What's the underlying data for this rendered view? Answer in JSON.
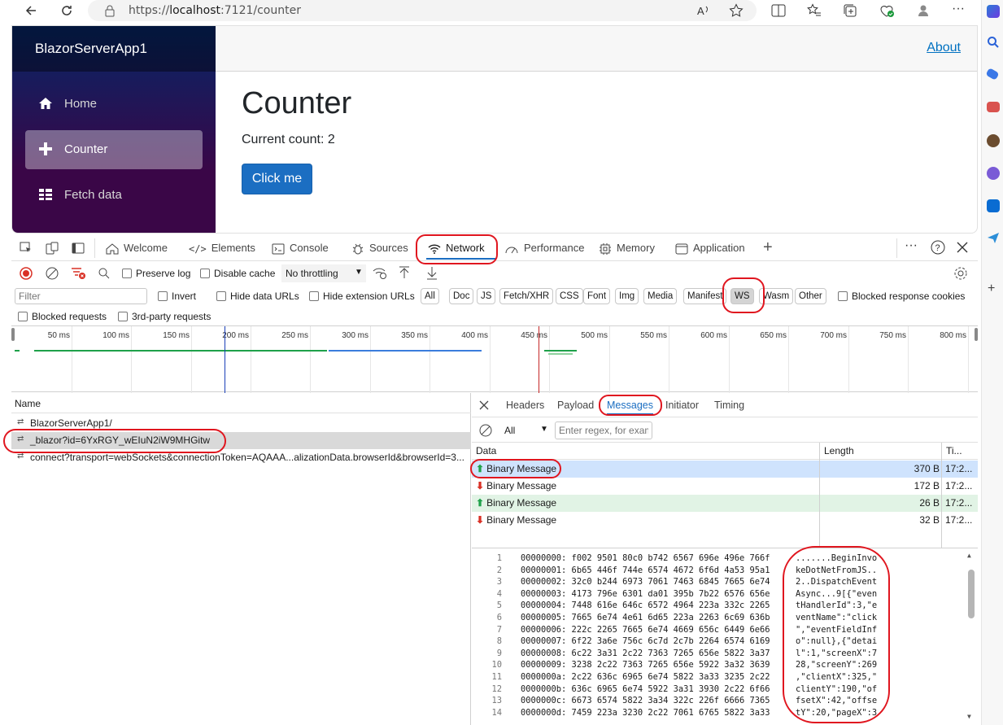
{
  "browser": {
    "url_scheme": "https://",
    "url_host": "localhost",
    "url_rest": ":7121/counter"
  },
  "app": {
    "brand": "BlazorServerApp1",
    "nav": [
      {
        "label": "Home",
        "icon": "home-icon"
      },
      {
        "label": "Counter",
        "icon": "plus-icon"
      },
      {
        "label": "Fetch data",
        "icon": "list-icon"
      }
    ],
    "about_link": "About",
    "page_title": "Counter",
    "current_count": "Current count: 2",
    "click_button": "Click me"
  },
  "devtools": {
    "tabs": [
      "Welcome",
      "Elements",
      "Console",
      "Sources",
      "Network",
      "Performance",
      "Memory",
      "Application"
    ],
    "active_tab": "Network",
    "toolbar": {
      "preserve_log": "Preserve log",
      "disable_cache": "Disable cache",
      "throttling": "No throttling"
    },
    "filter": {
      "placeholder": "Filter",
      "invert": "Invert",
      "hide_data_urls": "Hide data URLs",
      "hide_extension_urls": "Hide extension URLs",
      "types": [
        "All",
        "Doc",
        "JS",
        "Fetch/XHR",
        "CSS",
        "Font",
        "Img",
        "Media",
        "Manifest",
        "WS",
        "Wasm",
        "Other"
      ],
      "active_type": "WS",
      "blocked_response_cookies": "Blocked response cookies",
      "blocked_requests": "Blocked requests",
      "third_party_requests": "3rd-party requests"
    },
    "timeline_ticks": [
      "50 ms",
      "100 ms",
      "150 ms",
      "200 ms",
      "250 ms",
      "300 ms",
      "350 ms",
      "400 ms",
      "450 ms",
      "500 ms",
      "550 ms",
      "600 ms",
      "650 ms",
      "700 ms",
      "750 ms",
      "800 ms"
    ],
    "requests_header": "Name",
    "requests": [
      {
        "name": "BlazorServerApp1/"
      },
      {
        "name": "_blazor?id=6YxRGY_wEIuN2iW9MHGitw"
      },
      {
        "name": "connect?transport=webSockets&connectionToken=AQAAA...alizationData.browserId&browserId=3..."
      }
    ],
    "detail_tabs": [
      "Headers",
      "Payload",
      "Messages",
      "Initiator",
      "Timing"
    ],
    "active_detail_tab": "Messages",
    "message_filter": {
      "select": "All",
      "placeholder": "Enter regex, for exam"
    },
    "messages_columns": [
      "Data",
      "Length",
      "Ti..."
    ],
    "messages": [
      {
        "direction": "up",
        "data": "Binary Message",
        "length": "370 B",
        "time": "17:2..."
      },
      {
        "direction": "down",
        "data": "Binary Message",
        "length": "172 B",
        "time": "17:2..."
      },
      {
        "direction": "up",
        "data": "Binary Message",
        "length": "26 B",
        "time": "17:2..."
      },
      {
        "direction": "down",
        "data": "Binary Message",
        "length": "32 B",
        "time": "17:2..."
      }
    ],
    "hex_lines": [
      {
        "n": "1",
        "hex": "00000000: f002 9501 80c0 b742 6567 696e 496e 766f",
        "ascii": ".......BeginInvo"
      },
      {
        "n": "2",
        "hex": "00000001: 6b65 446f 744e 6574 4672 6f6d 4a53 95a1",
        "ascii": "keDotNetFromJS.."
      },
      {
        "n": "3",
        "hex": "00000002: 32c0 b244 6973 7061 7463 6845 7665 6e74",
        "ascii": "2..DispatchEvent"
      },
      {
        "n": "4",
        "hex": "00000003: 4173 796e 6301 da01 395b 7b22 6576 656e",
        "ascii": "Async...9[{\"even"
      },
      {
        "n": "5",
        "hex": "00000004: 7448 616e 646c 6572 4964 223a 332c 2265",
        "ascii": "tHandlerId\":3,\"e"
      },
      {
        "n": "6",
        "hex": "00000005: 7665 6e74 4e61 6d65 223a 2263 6c69 636b",
        "ascii": "ventName\":\"click"
      },
      {
        "n": "7",
        "hex": "00000006: 222c 2265 7665 6e74 4669 656c 6449 6e66",
        "ascii": "\",\"eventFieldInf"
      },
      {
        "n": "8",
        "hex": "00000007: 6f22 3a6e 756c 6c7d 2c7b 2264 6574 6169",
        "ascii": "o\":null},{\"detai"
      },
      {
        "n": "9",
        "hex": "00000008: 6c22 3a31 2c22 7363 7265 656e 5822 3a37",
        "ascii": "l\":1,\"screenX\":7"
      },
      {
        "n": "10",
        "hex": "00000009: 3238 2c22 7363 7265 656e 5922 3a32 3639",
        "ascii": "28,\"screenY\":269"
      },
      {
        "n": "11",
        "hex": "0000000a: 2c22 636c 6965 6e74 5822 3a33 3235 2c22",
        "ascii": ",\"clientX\":325,\""
      },
      {
        "n": "12",
        "hex": "0000000b: 636c 6965 6e74 5922 3a31 3930 2c22 6f66",
        "ascii": "clientY\":190,\"of"
      },
      {
        "n": "13",
        "hex": "0000000c: 6673 6574 5822 3a34 322c 226f 6666 7365",
        "ascii": "fsetX\":42,\"offse"
      },
      {
        "n": "14",
        "hex": "0000000d: 7459 223a 3230 2c22 7061 6765 5822 3a33",
        "ascii": "tY\":20,\"pageX\":3"
      }
    ]
  },
  "colors": {
    "annotation_red": "#e0161f",
    "brand_blue": "#1b6ec2",
    "selected_row": "#cfe3fd"
  }
}
